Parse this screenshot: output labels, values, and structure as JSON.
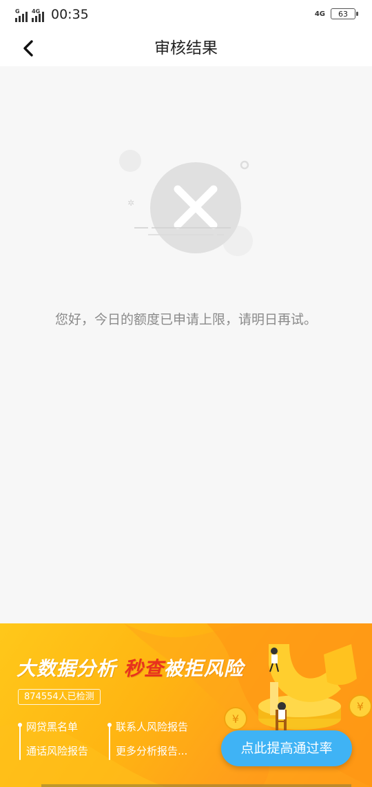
{
  "status_bar": {
    "signal1_label": "G",
    "signal2_label": "4G",
    "time": "00:35",
    "network": "4G",
    "battery": "63"
  },
  "header": {
    "title": "审核结果"
  },
  "content": {
    "message": "您好，今日的额度已申请上限，请明日再试。"
  },
  "banner": {
    "title_part1": "大数据分析 ",
    "title_highlight": "秒查",
    "title_part2": "被拒风险",
    "checked_count": "874554人已检测",
    "features_col1": [
      "网贷黑名单",
      "通话风险报告"
    ],
    "features_col2": [
      "联系人风险报告",
      "更多分析报告..."
    ],
    "cta_label": "点此提高通过率",
    "coin_symbol": "¥"
  },
  "colors": {
    "accent_orange": "#ffb512",
    "cta_blue": "#3fb3f5",
    "highlight_red": "#e8321e"
  }
}
